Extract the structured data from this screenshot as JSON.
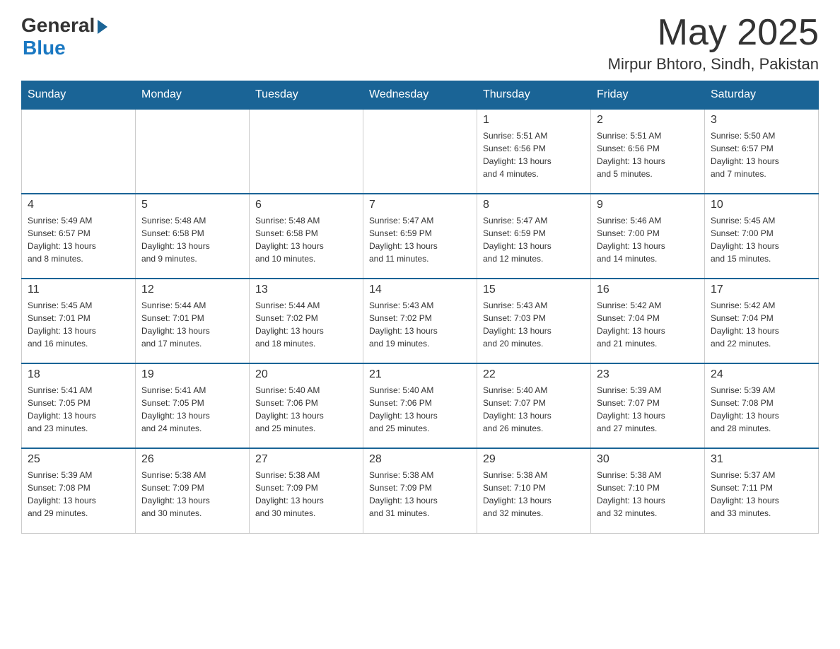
{
  "header": {
    "logo_general": "General",
    "logo_blue": "Blue",
    "month_year": "May 2025",
    "location": "Mirpur Bhtoro, Sindh, Pakistan"
  },
  "days_of_week": [
    "Sunday",
    "Monday",
    "Tuesday",
    "Wednesday",
    "Thursday",
    "Friday",
    "Saturday"
  ],
  "weeks": [
    [
      {
        "day": "",
        "info": ""
      },
      {
        "day": "",
        "info": ""
      },
      {
        "day": "",
        "info": ""
      },
      {
        "day": "",
        "info": ""
      },
      {
        "day": "1",
        "info": "Sunrise: 5:51 AM\nSunset: 6:56 PM\nDaylight: 13 hours\nand 4 minutes."
      },
      {
        "day": "2",
        "info": "Sunrise: 5:51 AM\nSunset: 6:56 PM\nDaylight: 13 hours\nand 5 minutes."
      },
      {
        "day": "3",
        "info": "Sunrise: 5:50 AM\nSunset: 6:57 PM\nDaylight: 13 hours\nand 7 minutes."
      }
    ],
    [
      {
        "day": "4",
        "info": "Sunrise: 5:49 AM\nSunset: 6:57 PM\nDaylight: 13 hours\nand 8 minutes."
      },
      {
        "day": "5",
        "info": "Sunrise: 5:48 AM\nSunset: 6:58 PM\nDaylight: 13 hours\nand 9 minutes."
      },
      {
        "day": "6",
        "info": "Sunrise: 5:48 AM\nSunset: 6:58 PM\nDaylight: 13 hours\nand 10 minutes."
      },
      {
        "day": "7",
        "info": "Sunrise: 5:47 AM\nSunset: 6:59 PM\nDaylight: 13 hours\nand 11 minutes."
      },
      {
        "day": "8",
        "info": "Sunrise: 5:47 AM\nSunset: 6:59 PM\nDaylight: 13 hours\nand 12 minutes."
      },
      {
        "day": "9",
        "info": "Sunrise: 5:46 AM\nSunset: 7:00 PM\nDaylight: 13 hours\nand 14 minutes."
      },
      {
        "day": "10",
        "info": "Sunrise: 5:45 AM\nSunset: 7:00 PM\nDaylight: 13 hours\nand 15 minutes."
      }
    ],
    [
      {
        "day": "11",
        "info": "Sunrise: 5:45 AM\nSunset: 7:01 PM\nDaylight: 13 hours\nand 16 minutes."
      },
      {
        "day": "12",
        "info": "Sunrise: 5:44 AM\nSunset: 7:01 PM\nDaylight: 13 hours\nand 17 minutes."
      },
      {
        "day": "13",
        "info": "Sunrise: 5:44 AM\nSunset: 7:02 PM\nDaylight: 13 hours\nand 18 minutes."
      },
      {
        "day": "14",
        "info": "Sunrise: 5:43 AM\nSunset: 7:02 PM\nDaylight: 13 hours\nand 19 minutes."
      },
      {
        "day": "15",
        "info": "Sunrise: 5:43 AM\nSunset: 7:03 PM\nDaylight: 13 hours\nand 20 minutes."
      },
      {
        "day": "16",
        "info": "Sunrise: 5:42 AM\nSunset: 7:04 PM\nDaylight: 13 hours\nand 21 minutes."
      },
      {
        "day": "17",
        "info": "Sunrise: 5:42 AM\nSunset: 7:04 PM\nDaylight: 13 hours\nand 22 minutes."
      }
    ],
    [
      {
        "day": "18",
        "info": "Sunrise: 5:41 AM\nSunset: 7:05 PM\nDaylight: 13 hours\nand 23 minutes."
      },
      {
        "day": "19",
        "info": "Sunrise: 5:41 AM\nSunset: 7:05 PM\nDaylight: 13 hours\nand 24 minutes."
      },
      {
        "day": "20",
        "info": "Sunrise: 5:40 AM\nSunset: 7:06 PM\nDaylight: 13 hours\nand 25 minutes."
      },
      {
        "day": "21",
        "info": "Sunrise: 5:40 AM\nSunset: 7:06 PM\nDaylight: 13 hours\nand 25 minutes."
      },
      {
        "day": "22",
        "info": "Sunrise: 5:40 AM\nSunset: 7:07 PM\nDaylight: 13 hours\nand 26 minutes."
      },
      {
        "day": "23",
        "info": "Sunrise: 5:39 AM\nSunset: 7:07 PM\nDaylight: 13 hours\nand 27 minutes."
      },
      {
        "day": "24",
        "info": "Sunrise: 5:39 AM\nSunset: 7:08 PM\nDaylight: 13 hours\nand 28 minutes."
      }
    ],
    [
      {
        "day": "25",
        "info": "Sunrise: 5:39 AM\nSunset: 7:08 PM\nDaylight: 13 hours\nand 29 minutes."
      },
      {
        "day": "26",
        "info": "Sunrise: 5:38 AM\nSunset: 7:09 PM\nDaylight: 13 hours\nand 30 minutes."
      },
      {
        "day": "27",
        "info": "Sunrise: 5:38 AM\nSunset: 7:09 PM\nDaylight: 13 hours\nand 30 minutes."
      },
      {
        "day": "28",
        "info": "Sunrise: 5:38 AM\nSunset: 7:09 PM\nDaylight: 13 hours\nand 31 minutes."
      },
      {
        "day": "29",
        "info": "Sunrise: 5:38 AM\nSunset: 7:10 PM\nDaylight: 13 hours\nand 32 minutes."
      },
      {
        "day": "30",
        "info": "Sunrise: 5:38 AM\nSunset: 7:10 PM\nDaylight: 13 hours\nand 32 minutes."
      },
      {
        "day": "31",
        "info": "Sunrise: 5:37 AM\nSunset: 7:11 PM\nDaylight: 13 hours\nand 33 minutes."
      }
    ]
  ]
}
